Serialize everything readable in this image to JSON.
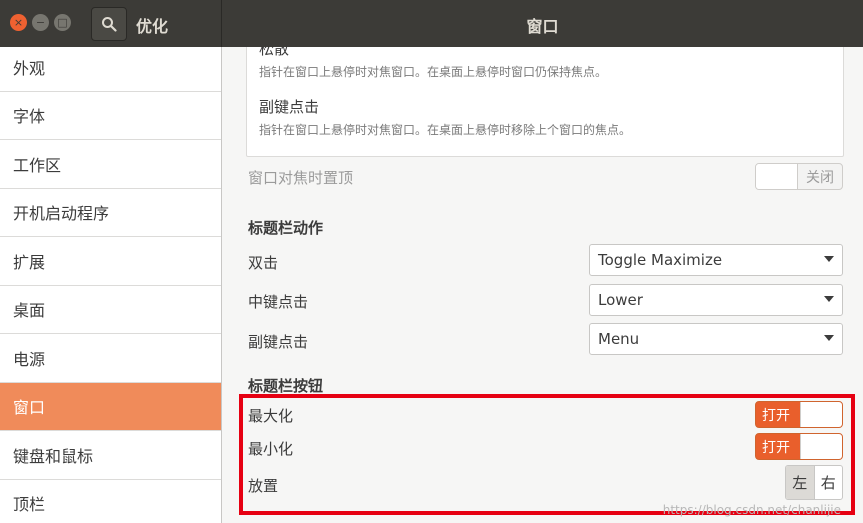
{
  "window": {
    "app_title": "优化",
    "header_title": "窗口",
    "close_glyph": "×",
    "minimize_glyph": "−",
    "maximize_glyph": "□"
  },
  "sidebar": {
    "items": [
      {
        "label": "外观"
      },
      {
        "label": "字体"
      },
      {
        "label": "工作区"
      },
      {
        "label": "开机启动程序"
      },
      {
        "label": "扩展"
      },
      {
        "label": "桌面"
      },
      {
        "label": "电源"
      },
      {
        "label": "窗口",
        "active": true
      },
      {
        "label": "键盘和鼠标"
      },
      {
        "label": "顶栏"
      }
    ]
  },
  "focus_mode": {
    "option_1": {
      "title": "松散",
      "desc": "指针在窗口上悬停时对焦窗口。在桌面上悬停时窗口仍保持焦点。"
    },
    "option_2": {
      "title": "副键点击",
      "desc": "指针在窗口上悬停时对焦窗口。在桌面上悬停时移除上个窗口的焦点。"
    }
  },
  "raise_on_focus": {
    "label": "窗口对焦时置顶",
    "state_label": "关闭"
  },
  "titlebar_actions": {
    "heading": "标题栏动作",
    "double_click": {
      "label": "双击",
      "value": "Toggle Maximize"
    },
    "middle_click": {
      "label": "中键点击",
      "value": "Lower"
    },
    "secondary_click": {
      "label": "副键点击",
      "value": "Menu"
    }
  },
  "titlebar_buttons": {
    "heading": "标题栏按钮",
    "maximize": {
      "label": "最大化",
      "state_label": "打开"
    },
    "minimize": {
      "label": "最小化",
      "state_label": "打开"
    },
    "placement": {
      "label": "放置",
      "left": "左",
      "right": "右",
      "selected": "左"
    }
  },
  "watermark": "https://blog.csdn.net/chanlijie",
  "colors": {
    "accent": "#f08b5a",
    "switch_on": "#e95f2c",
    "highlight": "#e60012",
    "titlebar": "#3c3b37"
  }
}
